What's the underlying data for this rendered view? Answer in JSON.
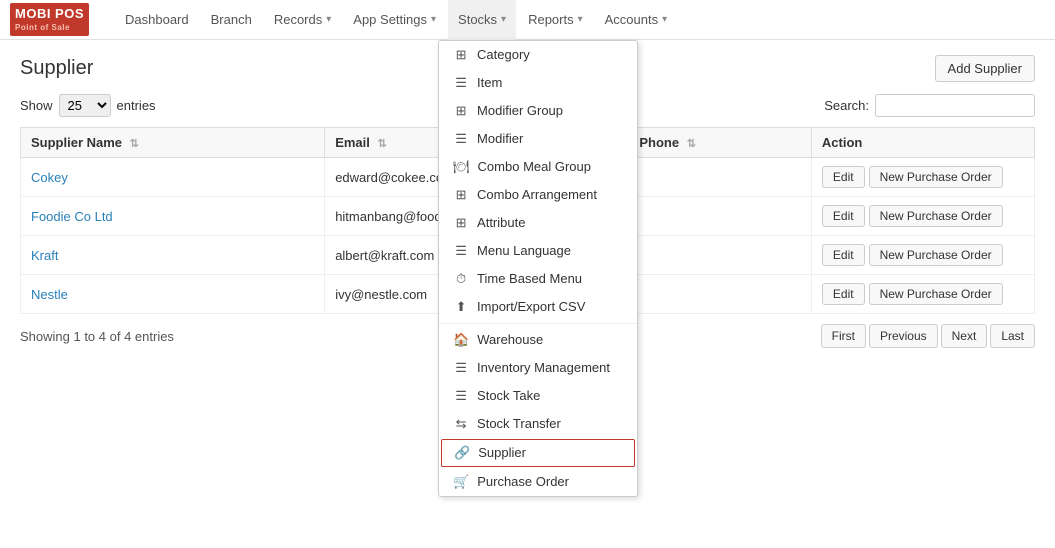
{
  "brand": {
    "name": "MOBI POS",
    "subtitle": "Point of Sale"
  },
  "navbar": {
    "items": [
      {
        "id": "dashboard",
        "label": "Dashboard",
        "hasDropdown": false
      },
      {
        "id": "branch",
        "label": "Branch",
        "hasDropdown": false
      },
      {
        "id": "records",
        "label": "Records",
        "hasDropdown": true
      },
      {
        "id": "app-settings",
        "label": "App Settings",
        "hasDropdown": true
      },
      {
        "id": "stocks",
        "label": "Stocks",
        "hasDropdown": true,
        "active": true
      },
      {
        "id": "reports",
        "label": "Reports",
        "hasDropdown": true
      },
      {
        "id": "accounts",
        "label": "Accounts",
        "hasDropdown": true
      }
    ]
  },
  "stocks_menu": {
    "items": [
      {
        "id": "category",
        "label": "Category",
        "icon": "⊞"
      },
      {
        "id": "item",
        "label": "Item",
        "icon": "☰"
      },
      {
        "id": "modifier-group",
        "label": "Modifier Group",
        "icon": "⊞"
      },
      {
        "id": "modifier",
        "label": "Modifier",
        "icon": "☰"
      },
      {
        "id": "combo-meal-group",
        "label": "Combo Meal Group",
        "icon": "🍽"
      },
      {
        "id": "combo-arrangement",
        "label": "Combo Arrangement",
        "icon": "⊞"
      },
      {
        "id": "attribute",
        "label": "Attribute",
        "icon": "⊞"
      },
      {
        "id": "menu-language",
        "label": "Menu Language",
        "icon": "☰"
      },
      {
        "id": "time-based-menu",
        "label": "Time Based Menu",
        "icon": "⏱"
      },
      {
        "id": "import-export-csv",
        "label": "Import/Export CSV",
        "icon": "⬆"
      },
      {
        "id": "warehouse",
        "label": "Warehouse",
        "icon": "🏠"
      },
      {
        "id": "inventory-management",
        "label": "Inventory Management",
        "icon": "☰"
      },
      {
        "id": "stock-take",
        "label": "Stock Take",
        "icon": "☰"
      },
      {
        "id": "stock-transfer",
        "label": "Stock Transfer",
        "icon": "⇆"
      },
      {
        "id": "supplier",
        "label": "Supplier",
        "icon": "🔗",
        "highlighted": true
      },
      {
        "id": "purchase-order",
        "label": "Purchase Order",
        "icon": "🛒"
      }
    ]
  },
  "page": {
    "title": "Supplier",
    "add_button": "Add Supplier",
    "show_label": "Show",
    "entries_label": "entries",
    "show_value": "25",
    "search_label": "Search:"
  },
  "table": {
    "columns": [
      {
        "id": "name",
        "label": "Supplier Name"
      },
      {
        "id": "email",
        "label": "Email"
      },
      {
        "id": "phone",
        "label": "Phone"
      },
      {
        "id": "action",
        "label": "Action"
      }
    ],
    "rows": [
      {
        "name": "Cokey",
        "email": "edward@cokee.com",
        "phone": "",
        "edit": "Edit",
        "new_po": "New Purchase Order"
      },
      {
        "name": "Foodie Co Ltd",
        "email": "hitmanbang@foodie.com",
        "phone": "",
        "edit": "Edit",
        "new_po": "New Purchase Order"
      },
      {
        "name": "Kraft",
        "email": "albert@kraft.com",
        "phone": "",
        "edit": "Edit",
        "new_po": "New Purchase Order"
      },
      {
        "name": "Nestle",
        "email": "ivy@nestle.com",
        "phone": "",
        "edit": "Edit",
        "new_po": "New Purchase Order"
      }
    ]
  },
  "pagination": {
    "info": "Showing 1 to 4 of 4 entries",
    "buttons": [
      "First",
      "Previous",
      "Next",
      "Last"
    ]
  }
}
